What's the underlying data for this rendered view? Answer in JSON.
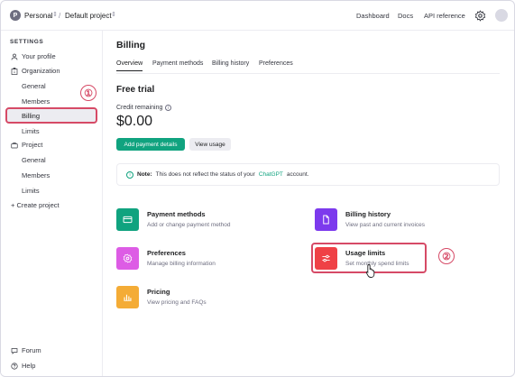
{
  "topbar": {
    "org_initial": "P",
    "org_name": "Personal",
    "separator": "/",
    "project_name": "Default project",
    "links": [
      "Dashboard",
      "Docs",
      "API reference"
    ]
  },
  "sidebar": {
    "section_heading": "SETTINGS",
    "your_profile": "Your profile",
    "organization": "Organization",
    "org_items": [
      "General",
      "Members",
      "Billing",
      "Limits"
    ],
    "project": "Project",
    "project_items": [
      "General",
      "Members",
      "Limits"
    ],
    "create_project": "+ Create project",
    "forum": "Forum",
    "help": "Help"
  },
  "callouts": [
    "①",
    "②"
  ],
  "main": {
    "title": "Billing",
    "tabs": [
      "Overview",
      "Payment methods",
      "Billing history",
      "Preferences"
    ],
    "plan_heading": "Free trial",
    "credit_label": "Credit remaining",
    "info_glyph": "i",
    "credit_amount": "$0.00",
    "add_payment_label": "Add payment details",
    "view_usage_label": "View usage",
    "note": {
      "bold": "Note:",
      "text_before": "This does not reflect the status of your",
      "link": "ChatGPT",
      "text_after": "account."
    },
    "cards": [
      {
        "title": "Payment methods",
        "desc": "Add or change payment method",
        "color": "#10a37f",
        "icon": "credit-card-icon"
      },
      {
        "title": "Billing history",
        "desc": "View past and current invoices",
        "color": "#7c3aed",
        "icon": "document-icon"
      },
      {
        "title": "Preferences",
        "desc": "Manage billing information",
        "color": "#dd5ce5",
        "icon": "gear-icon"
      },
      {
        "title": "Usage limits",
        "desc": "Set monthly spend limits",
        "color": "#ef4146",
        "icon": "sliders-icon"
      },
      {
        "title": "Pricing",
        "desc": "View pricing and FAQs",
        "color": "#f4ac36",
        "icon": "chart-icon"
      }
    ]
  },
  "colors": {
    "accent_green": "#10a37f",
    "highlight": "#d64a66"
  }
}
